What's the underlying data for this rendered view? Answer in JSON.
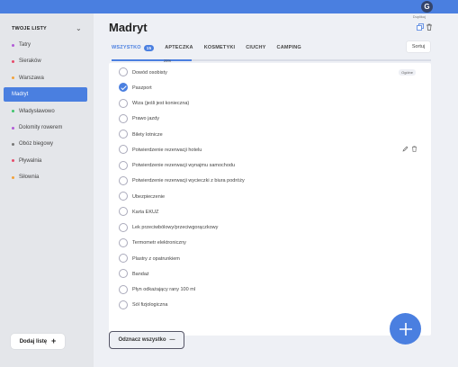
{
  "header": {
    "avatar_letter": "G"
  },
  "sidebar": {
    "title": "TWOJE LISTY",
    "items": [
      {
        "label": "Tatry",
        "dot_color": "#b25bd8"
      },
      {
        "label": "Sieraków",
        "dot_color": "#e64b6a"
      },
      {
        "label": "Warszawa",
        "dot_color": "#f2a23a"
      },
      {
        "label": "Madryt",
        "dot_color": "#ffffff",
        "active": true
      },
      {
        "label": "Władysławowo",
        "dot_color": "#3ec46d"
      },
      {
        "label": "Dolomity rowerem",
        "dot_color": "#b25bd8"
      },
      {
        "label": "Obóz biegowy",
        "dot_color": "#777777"
      },
      {
        "label": "Pływalnia",
        "dot_color": "#e64b6a"
      },
      {
        "label": "Siłownia",
        "dot_color": "#f2a23a"
      }
    ],
    "add_list_label": "Dodaj listę"
  },
  "main": {
    "title": "Madryt",
    "duplicate_label": "Duplikuj",
    "tabs": [
      {
        "label": "WSZYSTKO",
        "badge": "15"
      },
      {
        "label": "APTECZKA"
      },
      {
        "label": "KOSMETYKI"
      },
      {
        "label": "CIUCHY"
      },
      {
        "label": "CAMPING"
      }
    ],
    "sort_label": "Sortuj",
    "progress": {
      "percent": 25,
      "label": "25%"
    },
    "items": [
      {
        "label": "Dowód osobisty",
        "checked": false,
        "tag": "Ogólne"
      },
      {
        "label": "Paszport",
        "checked": true
      },
      {
        "label": "Wiza (jeśli jest konieczna)",
        "checked": false
      },
      {
        "label": "Prawo jazdy",
        "checked": false
      },
      {
        "label": "Bilety lotnicze",
        "checked": false
      },
      {
        "label": "Potwierdzenie rezerwacji hotelu",
        "checked": false,
        "hovered": true
      },
      {
        "label": "Potwierdzenie rezerwacji wynajmu samochodu",
        "checked": false
      },
      {
        "label": "Potwierdzenie rezerwacji wycieczki z biura podróży",
        "checked": false
      },
      {
        "label": "Ubezpieczenie",
        "checked": false
      },
      {
        "label": "Karta EKUZ",
        "checked": false
      },
      {
        "label": "Lek przeciwbólowy/przeciwgorączkowy",
        "checked": false
      },
      {
        "label": "Termometr elektroniczny",
        "checked": false
      },
      {
        "label": "Plastry z opatrunkiem",
        "checked": false
      },
      {
        "label": "Bandaż",
        "checked": false
      },
      {
        "label": "Płyn odkażający rany 100 ml",
        "checked": false
      },
      {
        "label": "Sól fizjologiczna",
        "checked": false
      }
    ],
    "uncheck_all_label": "Odznacz wszystko"
  },
  "colors": {
    "accent": "#4a7fe0",
    "sidebar_bg": "#e4e6ea",
    "page_bg": "#eef0f5"
  }
}
